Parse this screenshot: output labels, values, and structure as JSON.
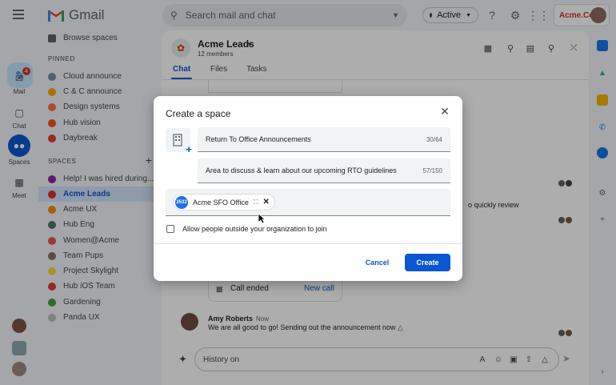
{
  "appbar": {
    "product_name": "Gmail",
    "search_placeholder": "Search mail and chat",
    "status_label": "Active",
    "brand_name": "Acme.Co"
  },
  "rail": {
    "items": [
      {
        "label": "Mail",
        "badge": "4"
      },
      {
        "label": "Chat"
      },
      {
        "label": "Spaces"
      },
      {
        "label": "Meet"
      }
    ]
  },
  "sidebar": {
    "browse": "Browse spaces",
    "pinned_header": "PINNED",
    "pinned": [
      "Cloud announce",
      "C & C announce",
      "Design systems",
      "Hub vision",
      "Daybreak"
    ],
    "spaces_header": "SPACES",
    "spaces": [
      "Help! I was hired during...",
      "Acme Leads",
      "Acme UX",
      "Hub Eng",
      "Women@Acme",
      "Team Pups",
      "Project Skylight",
      "Hub iOS Team",
      "Gardening",
      "Panda UX"
    ]
  },
  "room": {
    "title": "Acme Leads",
    "members": "12 members",
    "tabs": [
      "Chat",
      "Files",
      "Tasks"
    ],
    "partial_message": "o quickly review",
    "call_ended": "Call ended",
    "new_call": "New call",
    "message_author": "Amy Roberts",
    "message_time": "Now",
    "message_text": "We are all good to go! Sending out the announcement now",
    "composer_placeholder": "History on"
  },
  "dialog": {
    "title": "Create a space",
    "name_value": "Return To Office Announcements",
    "name_count": "30/64",
    "desc_value": "Area to discuss & learn about our upcoming RTO guidelines",
    "desc_count": "57/150",
    "chip_badge": "2532",
    "chip_label": "Acme SFO Office",
    "checkbox_label": "Allow people outside your organization to join",
    "cancel_label": "Cancel",
    "create_label": "Create"
  },
  "colors": {
    "accent": "#0b57d0",
    "active_row": "#d3e3fd",
    "overlay": "rgba(0,0,0,0.32)"
  }
}
